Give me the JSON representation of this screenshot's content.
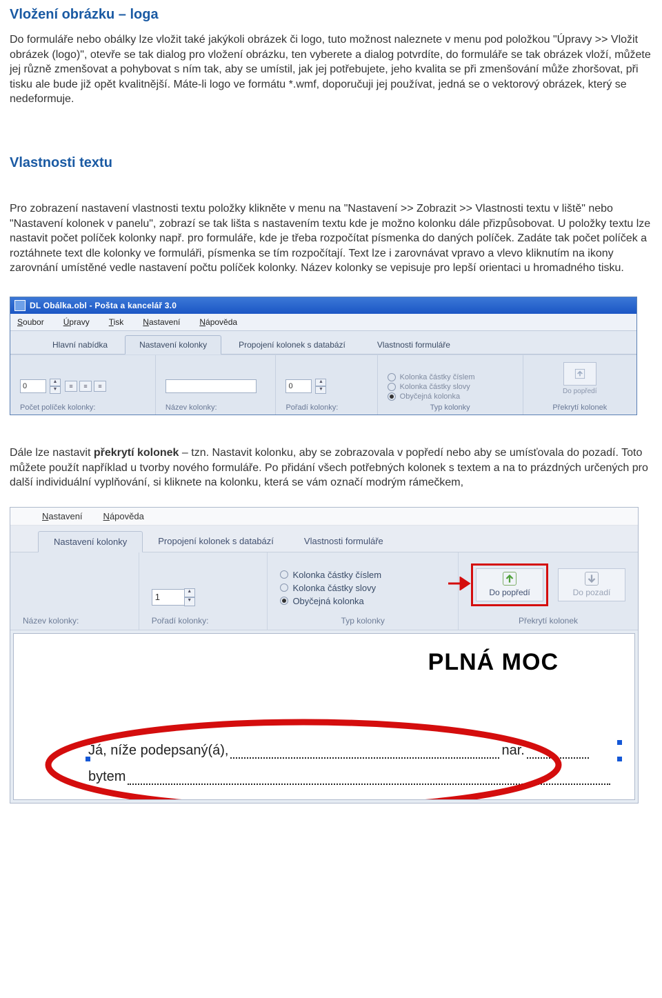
{
  "headings": {
    "h1": "Vložení obrázku – loga",
    "h2": "Vlastnosti textu"
  },
  "paragraphs": {
    "p1": "Do formuláře nebo obálky lze vložit také jakýkoli obrázek či logo, tuto možnost naleznete v menu pod položkou \"Úpravy >> Vložit obrázek (logo)\", otevře se tak dialog pro vložení obrázku, ten vyberete a dialog potvrdíte, do formuláře se tak obrázek vloží, můžete jej různě zmenšovat a pohybovat s ním tak, aby se umístil, jak jej potřebujete, jeho kvalita se při zmenšování může zhoršovat, při tisku ale bude již opět kvalitnější. Máte-li logo ve formátu *.wmf, doporučuji jej používat, jedná se o vektorový obrázek, který se nedeformuje.",
    "p2": "Pro zobrazení nastavení vlastnosti textu položky klikněte v menu na \"Nastavení >> Zobrazit >> Vlastnosti textu v liště\" nebo \"Nastavení kolonek v panelu\", zobrazí se tak lišta s nastavením textu kde je možno kolonku dále přizpůsobovat. U položky textu lze nastavit počet políček kolonky např. pro formuláře, kde je třeba rozpočítat písmenka do daných políček. Zadáte tak počet políček a roztáhnete text dle kolonky ve formuláři, písmenka se tím rozpočítají. Text lze i zarovnávat vpravo a vlevo kliknutím na ikony zarovnání umístěné vedle nastavení počtu políček kolonky. Název kolonky se vepisuje pro lepší orientaci u hromadného tisku.",
    "p3a": "Dále lze nastavit ",
    "p3b": "překrytí kolonek",
    "p3c": " – tzn. Nastavit kolonku, aby se zobrazovala v popředí nebo aby se umísťovala do pozadí. Toto můžete použít například u tvorby nového formuláře. Po přidání všech potřebných kolonek s textem a na to prázdných určených pro další individuální vyplňování, si kliknete na kolonku, která se vám označí modrým rámečkem,"
  },
  "shot1": {
    "title": "DL Obálka.obl - Pošta a kancelář 3.0",
    "menu": [
      "Soubor",
      "Úpravy",
      "Tisk",
      "Nastavení",
      "Nápověda"
    ],
    "tabs": [
      "Hlavní nabídka",
      "Nastavení kolonky",
      "Propojení kolonek s databází",
      "Vlastnosti formuláře"
    ],
    "active_tab": 1,
    "group_labels": [
      "Počet políček kolonky:",
      "Název kolonky:",
      "Pořadí kolonky:",
      "Typ kolonky",
      "Překrytí kolonek"
    ],
    "count_value": "0",
    "order_value": "0",
    "type_options": [
      "Kolonka částky číslem",
      "Kolonka částky slovy",
      "Obyčejná kolonka"
    ],
    "type_selected": 2,
    "foreground_btn": "Do popředí"
  },
  "shot2": {
    "menu": [
      "Nastavení",
      "Nápověda"
    ],
    "tabs": [
      "Nastavení kolonky",
      "Propojení kolonek s databází",
      "Vlastnosti formuláře"
    ],
    "active_tab": 0,
    "group_labels": [
      "Název kolonky:",
      "Pořadí kolonky:",
      "Typ kolonky",
      "Překrytí kolonek"
    ],
    "order_value": "1",
    "type_options": [
      "Kolonka částky číslem",
      "Kolonka částky slovy",
      "Obyčejná kolonka"
    ],
    "type_selected": 2,
    "btn_fore": "Do popředí",
    "btn_back": "Do pozadí",
    "form_title": "PLNÁ MOC",
    "line1_a": "Já, níže podepsaný(á),",
    "line1_b": "nar.",
    "line2": "bytem"
  }
}
